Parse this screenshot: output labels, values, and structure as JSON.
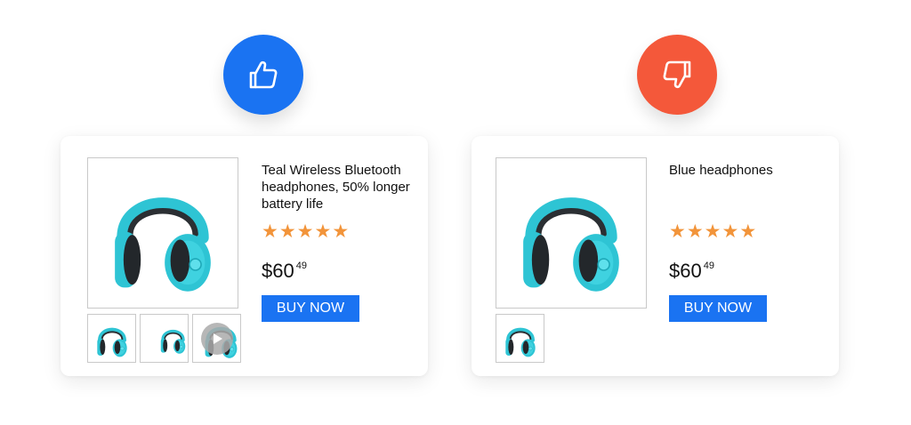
{
  "good": {
    "badge_icon": "thumbs-up-icon",
    "badge_color": "#1a73f2",
    "product_title": "Teal Wireless Bluetooth headphones, 50% longer battery life",
    "rating_stars": 5,
    "price_main": "$60",
    "price_cents": "49",
    "buy_label": "BUY NOW",
    "thumbnails": [
      "headphones-front",
      "headphones-closeup",
      "video-play"
    ]
  },
  "bad": {
    "badge_icon": "thumbs-down-icon",
    "badge_color": "#f4583a",
    "product_title": "Blue headphones",
    "rating_stars": 5,
    "price_main": "$60",
    "price_cents": "49",
    "buy_label": "BUY NOW",
    "thumbnails": [
      "headphones-front"
    ]
  },
  "colors": {
    "button": "#1a73f2",
    "star": "#f2943a",
    "headphone_teal": "#2ec4d4"
  }
}
